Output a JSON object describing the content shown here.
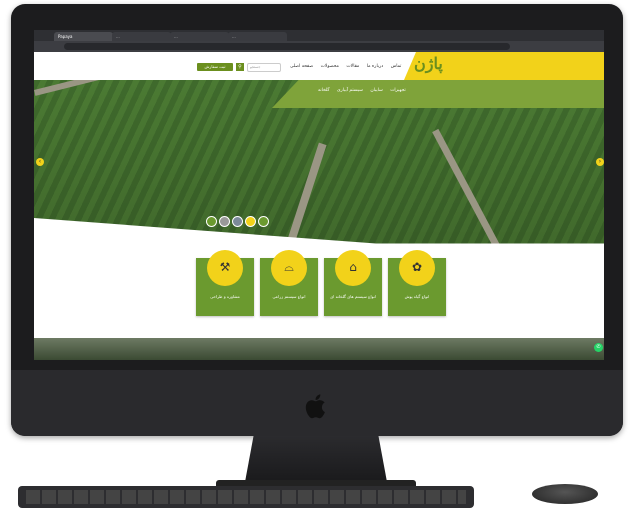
{
  "browser": {
    "tabs": [
      {
        "label": "Papaya"
      },
      {
        "label": "..."
      },
      {
        "label": "..."
      },
      {
        "label": "..."
      }
    ],
    "address": ""
  },
  "header": {
    "logo_text": "پاژن",
    "nav": [
      "صفحه اصلی",
      "محصولات",
      "مقالات",
      "درباره ما",
      "تماس"
    ],
    "search_placeholder": "جستجو",
    "cta_label": "ثبت سفارش"
  },
  "subnav": {
    "items": [
      "گلخانه",
      "سیستم آبیاری",
      "سایبان",
      "تجهیزات"
    ]
  },
  "intro": {
    "text": ""
  },
  "cards": [
    {
      "label": "انواع گیاه پوش",
      "icon": "plant-icon"
    },
    {
      "label": "انواع سیستم های گلخانه ای",
      "icon": "dome-icon"
    },
    {
      "label": "انواع سیستم زراعی",
      "icon": "tunnel-icon"
    },
    {
      "label": "مشاوره و طراحی",
      "icon": "tools-icon"
    }
  ],
  "colors": {
    "brand_green": "#6b9a2f",
    "brand_yellow": "#f2d21a",
    "whatsapp": "#25d366"
  }
}
